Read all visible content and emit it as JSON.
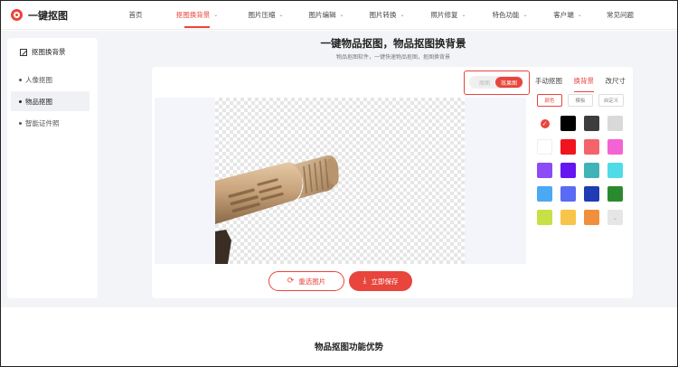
{
  "brand": {
    "name": "一键抠图",
    "accent": "#e8453c"
  },
  "nav": {
    "items": [
      {
        "label": "首页",
        "dropdown": false,
        "active": false,
        "width": 52
      },
      {
        "label": "抠图换背景",
        "dropdown": true,
        "active": true,
        "width": 84
      },
      {
        "label": "图片压缩",
        "dropdown": true,
        "active": false,
        "width": 68
      },
      {
        "label": "图片编辑",
        "dropdown": true,
        "active": false,
        "width": 66
      },
      {
        "label": "图片转换",
        "dropdown": true,
        "active": false,
        "width": 68
      },
      {
        "label": "照片修复",
        "dropdown": true,
        "active": false,
        "width": 68
      },
      {
        "label": "特色功能",
        "dropdown": true,
        "active": false,
        "width": 68
      },
      {
        "label": "客户端",
        "dropdown": true,
        "active": false,
        "width": 60
      },
      {
        "label": "常见问题",
        "dropdown": false,
        "active": false,
        "width": 56
      }
    ]
  },
  "sidebar": {
    "title": "抠图换背景",
    "items": [
      {
        "label": "人像抠图",
        "active": false
      },
      {
        "label": "物品抠图",
        "active": true
      },
      {
        "label": "智能证件照",
        "active": false
      }
    ]
  },
  "main": {
    "title": "一键物品抠图，物品抠图换背景",
    "subtitle": "物品抠图软件，一键快速物品抠图，抠图换背景"
  },
  "toggle": {
    "original_label": "原图",
    "result_label": "效果图"
  },
  "tools": {
    "tabs": [
      "手动抠图",
      "换背景",
      "改尺寸"
    ],
    "active_tab": 1,
    "sub_tabs": [
      "颜色",
      "模板",
      "自定义"
    ],
    "active_sub_tab": 0
  },
  "swatches": [
    "none",
    "#000000",
    "#3d3d3d",
    "#d9d9d9",
    "#ffffff",
    "#f0141e",
    "#f5636b",
    "#f463d3",
    "#8c4bf4",
    "#6415f0",
    "#40b3b6",
    "#4fdce6",
    "#4aa9f2",
    "#5a6af4",
    "#1f3cb4",
    "#2a8a2e",
    "#c6e046",
    "#f8c54a",
    "#f0903c",
    "more"
  ],
  "actions": {
    "reselect_label": "重选图片",
    "save_label": "立即保存"
  },
  "section": {
    "title": "物品抠图功能优势"
  }
}
